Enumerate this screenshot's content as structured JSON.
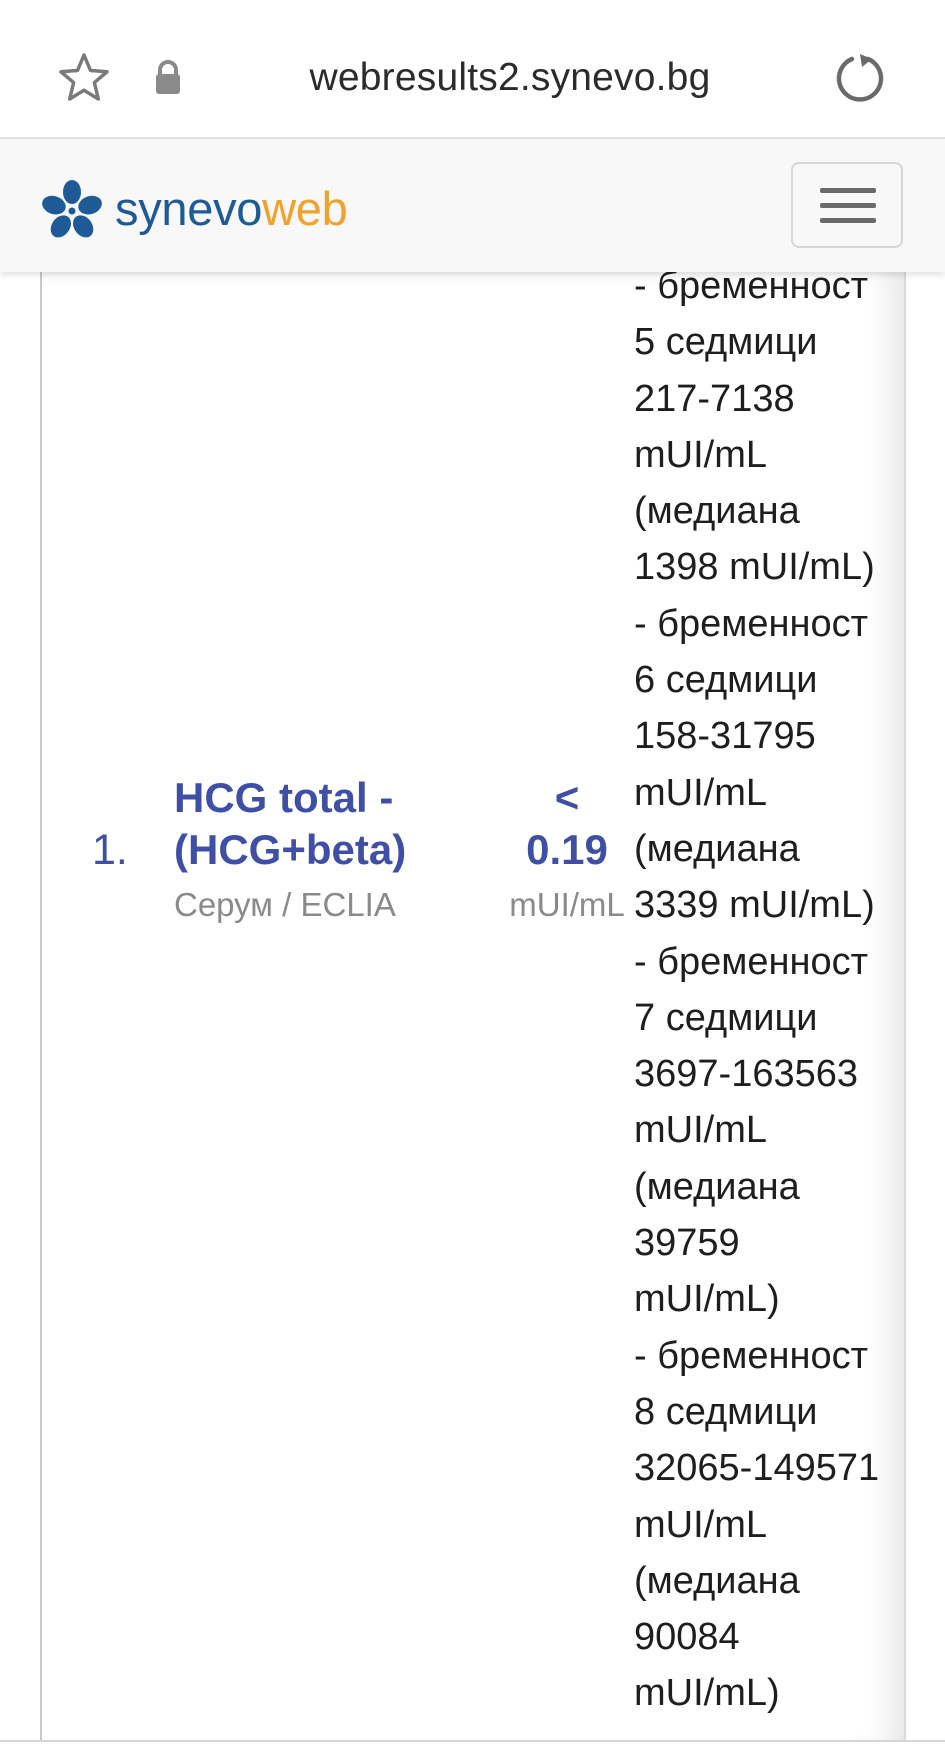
{
  "browser": {
    "url": "webresults2.synevo.bg"
  },
  "site": {
    "brand_part1": "synevo",
    "brand_part2": "web",
    "brand_color_primary": "#1d5a96",
    "brand_color_accent": "#f1a22b"
  },
  "result": {
    "index": "1.",
    "name_line1": "HCG total -",
    "name_line2": "(HCG+beta)",
    "meta": "Серум / ECLIA",
    "value_prefix": "<",
    "value": "0.19",
    "unit": "mUI/mL",
    "reference_lines": [
      "- бременност",
      "5 седмици",
      "217-7138",
      "mUI/mL",
      "(медиана",
      "1398 mUI/mL)",
      "- бременност",
      "6 седмици",
      "158-31795",
      "mUI/mL",
      "(медиана",
      "3339 mUI/mL)",
      "- бременност",
      "7 седмици",
      "3697-163563",
      "mUI/mL",
      "(медиана",
      "39759",
      "mUI/mL)",
      "- бременност",
      "8 седмици",
      "32065-149571",
      "mUI/mL",
      "(медиана",
      "90084",
      "mUI/mL)"
    ]
  }
}
